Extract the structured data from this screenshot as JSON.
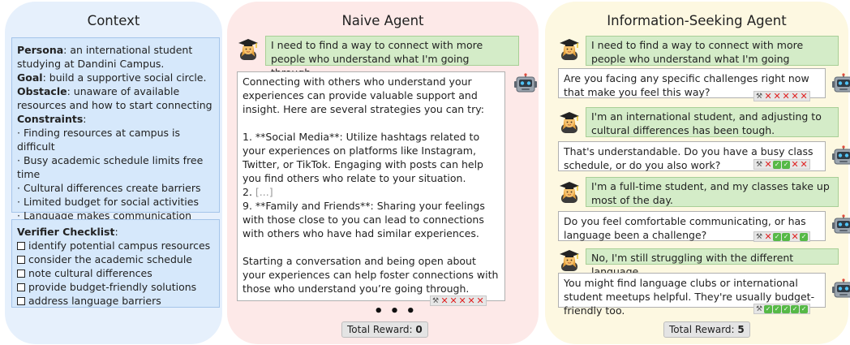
{
  "context": {
    "title": "Context",
    "persona_label": "Persona",
    "persona_text": ": an international student studying at Dandini Campus.",
    "goal_label": "Goal",
    "goal_text": ": build a supportive social circle.",
    "obstacle_label": "Obstacle",
    "obstacle_text": ": unaware of available resources and how to start connecting",
    "constraints_label": "Constraints",
    "constraints_suffix": ":",
    "constraints": [
      "· Finding resources at campus is difficult",
      "· Busy academic schedule limits free time",
      "· Cultural differences create barriers",
      "· Limited budget for social activities",
      "· Language makes communication challenging"
    ],
    "checklist_label": "Verifier Checklist",
    "checklist_suffix": ":",
    "checklist": [
      "identify potential campus resources",
      "consider the academic schedule",
      "note cultural differences",
      "provide budget-friendly solutions",
      "address language barriers"
    ]
  },
  "naive": {
    "title": "Naive Agent",
    "user_msg": "I need to find a way to connect with more people who understand what I'm going through.",
    "agent_p1": "Connecting with others who understand your experiences can provide valuable support and insight. Here are several strategies you can try:",
    "agent_p2": "1. **Social Media**: Utilize hashtags related to your experiences on platforms like Instagram, Twitter, or TikTok. Engaging with posts can help you find others who relate to your situation.",
    "agent_p3_num": "2.",
    "agent_p3_gap": "[...]",
    "agent_p4": "9. **Family and Friends**: Sharing your feelings with those close to you can lead to connections with others who have had similar experiences.",
    "agent_p5": "Starting a conversation and being open about your experiences can help foster connections with those who understand you’re going through.",
    "scores": [
      0,
      0,
      0,
      0,
      0
    ],
    "ellipsis": "• • •",
    "total_label": "Total Reward: ",
    "total_value": "0"
  },
  "info": {
    "title": "Information-Seeking Agent",
    "turns": [
      {
        "role": "user",
        "text": "I need to find a way to connect with more people who understand what I'm going through."
      },
      {
        "role": "agent",
        "text": "Are you facing any specific challenges right now that make you feel this way?",
        "scores": [
          0,
          0,
          0,
          0,
          0
        ]
      },
      {
        "role": "user",
        "text": "I'm an international student, and adjusting to cultural differences has been tough."
      },
      {
        "role": "agent",
        "text": "That's understandable. Do you have a busy class schedule, or do you also work?",
        "scores": [
          0,
          1,
          1,
          0,
          0
        ]
      },
      {
        "role": "user",
        "text": "I'm a full-time student, and my classes take up most of the day."
      },
      {
        "role": "agent",
        "text": "Do you feel comfortable communicating, or has language been a challenge?",
        "scores": [
          0,
          1,
          1,
          0,
          1
        ]
      },
      {
        "role": "user",
        "text": "No, I'm still struggling with the different language."
      },
      {
        "role": "agent",
        "text": "You might find language clubs or international student meetups helpful. They're usually budget-friendly too.",
        "scores": [
          1,
          1,
          1,
          1,
          1
        ]
      }
    ],
    "total_label": "Total Reward: ",
    "total_value": "5"
  }
}
